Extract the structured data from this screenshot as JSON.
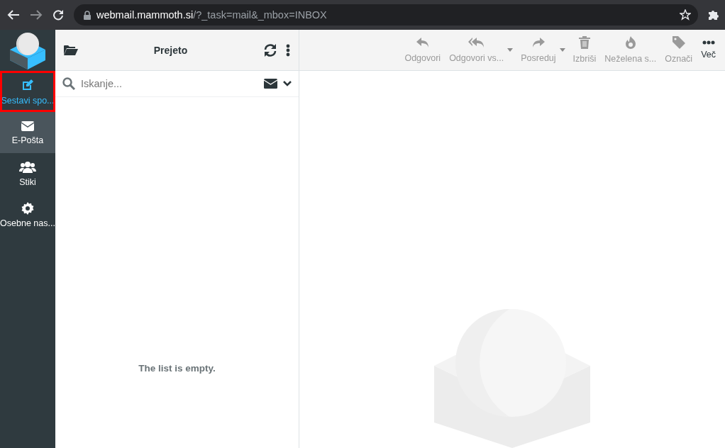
{
  "browser": {
    "url_host": "webmail.mammoth.si",
    "url_path": "/?_task=mail&_mbox=INBOX"
  },
  "sidebar": {
    "items": [
      {
        "kind": "compose",
        "label": "Sestavi spo...",
        "selected": false,
        "highlighted": true
      },
      {
        "kind": "mail",
        "label": "E-Pošta",
        "selected": true,
        "highlighted": false
      },
      {
        "kind": "contacts",
        "label": "Stiki",
        "selected": false,
        "highlighted": false
      },
      {
        "kind": "settings",
        "label": "Osebne nas...",
        "selected": false,
        "highlighted": false
      }
    ]
  },
  "list": {
    "title": "Prejeto",
    "search": {
      "placeholder": "Iskanje..."
    },
    "empty_message": "The list is empty."
  },
  "toolbar": {
    "buttons": [
      {
        "kind": "reply",
        "label": "Odgovori",
        "disabled": true,
        "dropdown": false
      },
      {
        "kind": "reply-all",
        "label": "Odgovori vs...",
        "disabled": true,
        "dropdown": true
      },
      {
        "kind": "forward",
        "label": "Posreduj",
        "disabled": true,
        "dropdown": true
      },
      {
        "kind": "delete",
        "label": "Izbriši",
        "disabled": true,
        "dropdown": false
      },
      {
        "kind": "junk",
        "label": "Neželena s...",
        "disabled": true,
        "dropdown": false
      },
      {
        "kind": "tag",
        "label": "Označi",
        "disabled": true,
        "dropdown": false
      },
      {
        "kind": "more",
        "label": "Več",
        "disabled": false,
        "dropdown": false
      }
    ]
  }
}
